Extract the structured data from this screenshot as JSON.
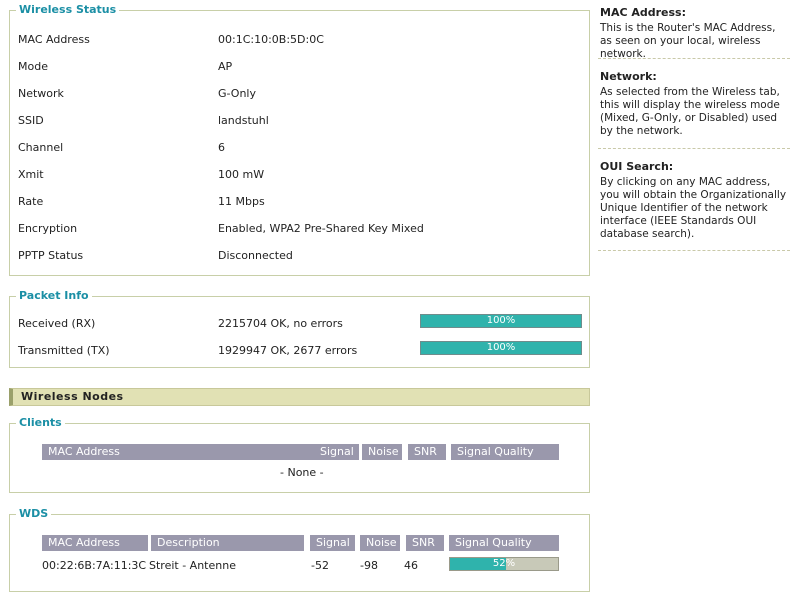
{
  "wireless_status": {
    "legend": "Wireless Status",
    "rows": [
      {
        "label": "MAC Address",
        "value": "00:1C:10:0B:5D:0C"
      },
      {
        "label": "Mode",
        "value": "AP"
      },
      {
        "label": "Network",
        "value": "G-Only"
      },
      {
        "label": "SSID",
        "value": "landstuhl"
      },
      {
        "label": "Channel",
        "value": "6"
      },
      {
        "label": "Xmit",
        "value": "100 mW"
      },
      {
        "label": "Rate",
        "value": "11 Mbps"
      },
      {
        "label": "Encryption",
        "value": "Enabled, WPA2 Pre-Shared Key Mixed"
      },
      {
        "label": "PPTP Status",
        "value": "Disconnected"
      }
    ]
  },
  "packet_info": {
    "legend": "Packet Info",
    "rows": [
      {
        "label": "Received (RX)",
        "value": "2215704 OK, no errors",
        "bar_text": "100%",
        "fraction": 1.0
      },
      {
        "label": "Transmitted (TX)",
        "value": "1929947 OK, 2677 errors",
        "bar_text": "100%",
        "fraction": 1.0
      }
    ]
  },
  "wireless_nodes": {
    "title": "Wireless Nodes"
  },
  "clients": {
    "legend": "Clients",
    "headers": [
      "MAC Address",
      "Signal",
      "Noise",
      "SNR",
      "Signal Quality"
    ],
    "empty_text": "- None -"
  },
  "wds": {
    "legend": "WDS",
    "headers": [
      "MAC Address",
      "Description",
      "Signal",
      "Noise",
      "SNR",
      "Signal Quality"
    ],
    "rows": [
      {
        "mac": "00:22:6B:7A:11:3C",
        "description": "Streit - Antenne",
        "signal": "-52",
        "noise": "-98",
        "snr": "46",
        "quality_text": "52%",
        "quality_fraction": 0.52
      }
    ]
  },
  "help": [
    {
      "title": "MAC Address:",
      "text": "This is the Router's MAC Address, as seen on your local, wireless network."
    },
    {
      "title": "Network:",
      "text": "As selected from the Wireless tab, this will display the wireless mode (Mixed, G-Only, or Disabled) used by the network."
    },
    {
      "title": "OUI Search:",
      "text": "By clicking on any MAC address, you will obtain the Organizationally Unique Identifier of the network interface (IEEE Standards OUI database search)."
    }
  ],
  "colors": {
    "legend": "#1b8fa5",
    "bar_fill": "#2fb3ac",
    "bar_empty": "#c8c9b8",
    "table_header": "#9a98ac",
    "section_bar": "#e1e1b4"
  }
}
